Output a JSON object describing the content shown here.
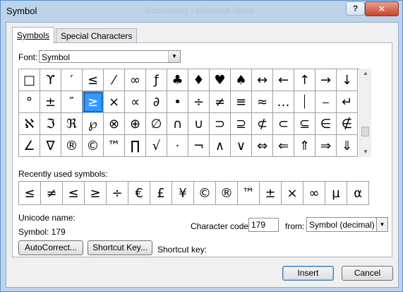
{
  "window": {
    "title": "Symbol",
    "background_title": "Document1 - Microsoft Word",
    "help_label": "?",
    "close_label": "✕"
  },
  "tabs": [
    {
      "label": "Symbols",
      "active": true
    },
    {
      "label": "Special Characters",
      "active": false
    }
  ],
  "font": {
    "label": "Font:",
    "value": "Symbol"
  },
  "symbol_grid": [
    [
      "□",
      "ϒ",
      "′",
      "≤",
      "⁄",
      "∞",
      "ƒ",
      "♣",
      "♦",
      "♥",
      "♠",
      "↔",
      "←",
      "↑",
      "→",
      "↓"
    ],
    [
      "°",
      "±",
      "″",
      "≥",
      "×",
      "∝",
      "∂",
      "•",
      "÷",
      "≠",
      "≡",
      "≈",
      "…",
      "⏐",
      "⎯",
      "↵"
    ],
    [
      "ℵ",
      "ℑ",
      "ℜ",
      "℘",
      "⊗",
      "⊕",
      "∅",
      "∩",
      "∪",
      "⊃",
      "⊇",
      "⊄",
      "⊂",
      "⊆",
      "∈",
      "∉"
    ],
    [
      "∠",
      "∇",
      "®",
      "©",
      "™",
      "∏",
      "√",
      "·",
      "¬",
      "∧",
      "∨",
      "⇔",
      "⇐",
      "⇑",
      "⇒",
      "⇓"
    ]
  ],
  "selected_symbol": "≥",
  "recent": {
    "label": "Recently used symbols:",
    "symbols": [
      "≤",
      "≠",
      "≤",
      "≥",
      "÷",
      "€",
      "£",
      "¥",
      "©",
      "®",
      "™",
      "±",
      "×",
      "∞",
      "µ",
      "α"
    ]
  },
  "unicode_name_label": "Unicode name:",
  "symbol_code_text": "Symbol: 179",
  "character_code": {
    "label": "Character code:",
    "value": "179"
  },
  "from": {
    "label": "from:",
    "value": "Symbol (decimal)"
  },
  "buttons": {
    "autocorrect": "AutoCorrect...",
    "shortcut_key": "Shortcut Key...",
    "insert": "Insert",
    "cancel": "Cancel"
  },
  "shortcut_key_label": "Shortcut key:"
}
